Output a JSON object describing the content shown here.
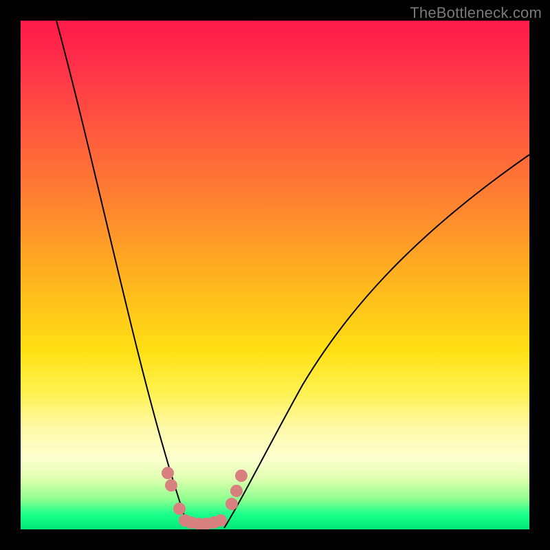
{
  "watermark": "TheBottleneck.com",
  "chart_data": {
    "type": "line",
    "title": "",
    "xlabel": "",
    "ylabel": "",
    "xlim": [
      0,
      100
    ],
    "ylim": [
      0,
      100
    ],
    "grid": false,
    "legend": false,
    "series": [
      {
        "name": "left-curve",
        "x": [
          7,
          10,
          13,
          16,
          19,
          22,
          25,
          27,
          29,
          31,
          33
        ],
        "y": [
          100,
          78,
          60,
          46,
          34,
          24,
          16,
          10,
          6,
          3,
          0
        ]
      },
      {
        "name": "right-curve",
        "x": [
          40,
          43,
          47,
          52,
          58,
          65,
          73,
          82,
          91,
          100
        ],
        "y": [
          0,
          4,
          10,
          18,
          28,
          38,
          48,
          58,
          66,
          74
        ]
      }
    ],
    "markers": {
      "name": "cluster",
      "color": "#d88080",
      "points": [
        {
          "x": 29.0,
          "y": 11.0
        },
        {
          "x": 29.7,
          "y": 8.5
        },
        {
          "x": 31.2,
          "y": 4.0
        },
        {
          "x": 32.3,
          "y": 1.6
        },
        {
          "x": 33.5,
          "y": 1.2
        },
        {
          "x": 35.0,
          "y": 1.0
        },
        {
          "x": 36.5,
          "y": 1.0
        },
        {
          "x": 38.0,
          "y": 1.2
        },
        {
          "x": 39.3,
          "y": 1.7
        },
        {
          "x": 41.5,
          "y": 5.0
        },
        {
          "x": 42.4,
          "y": 7.5
        },
        {
          "x": 43.4,
          "y": 10.5
        }
      ]
    }
  }
}
